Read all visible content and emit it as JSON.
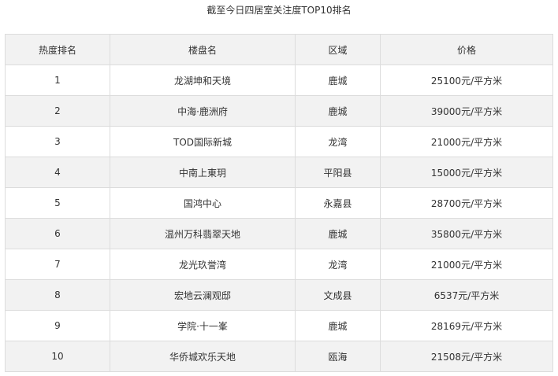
{
  "title": "截至今日四居室关注度TOP10排名",
  "table": {
    "headers": {
      "rank": "热度排名",
      "name": "楼盘名",
      "area": "区域",
      "price": "价格"
    },
    "rows": [
      {
        "rank": "1",
        "name": "龙湖坤和天境",
        "area": "鹿城",
        "price": "25100元/平方米"
      },
      {
        "rank": "2",
        "name": "中海·鹿洲府",
        "area": "鹿城",
        "price": "39000元/平方米"
      },
      {
        "rank": "3",
        "name": "TOD国际新城",
        "area": "龙湾",
        "price": "21000元/平方米"
      },
      {
        "rank": "4",
        "name": "中南上東玥",
        "area": "平阳县",
        "price": "15000元/平方米"
      },
      {
        "rank": "5",
        "name": "国鸿中心",
        "area": "永嘉县",
        "price": "28700元/平方米"
      },
      {
        "rank": "6",
        "name": "温州万科翡翠天地",
        "area": "鹿城",
        "price": "35800元/平方米"
      },
      {
        "rank": "7",
        "name": "龙光玖誉湾",
        "area": "龙湾",
        "price": "21000元/平方米"
      },
      {
        "rank": "8",
        "name": "宏地云澜观邸",
        "area": "文成县",
        "price": "6537元/平方米"
      },
      {
        "rank": "9",
        "name": "学院·十一峯",
        "area": "鹿城",
        "price": "28169元/平方米"
      },
      {
        "rank": "10",
        "name": "华侨城欢乐天地",
        "area": "瓯海",
        "price": "21508元/平方米"
      }
    ]
  }
}
